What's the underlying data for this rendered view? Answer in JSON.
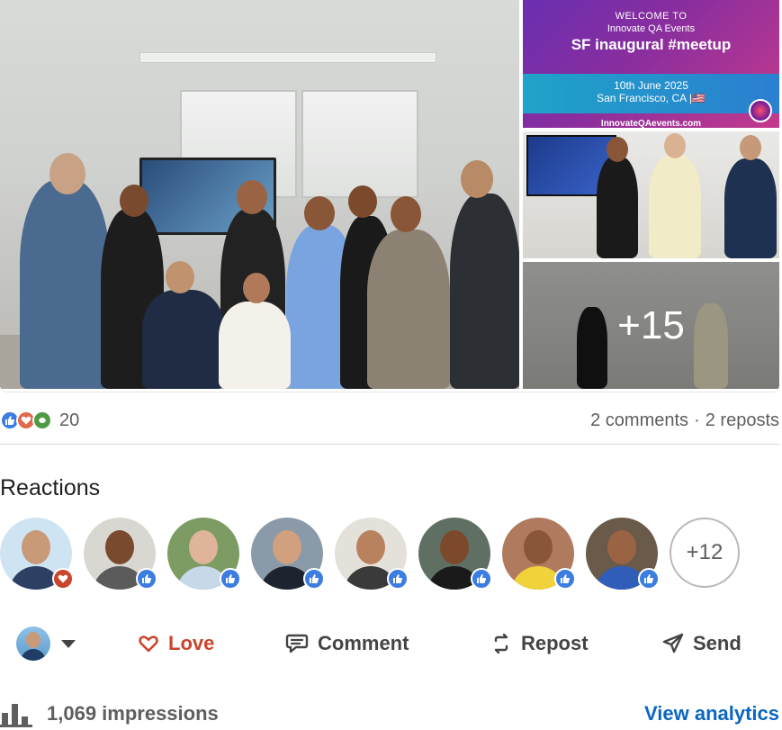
{
  "gallery": {
    "banner": {
      "line1": "WELCOME TO",
      "line2": "Innovate QA Events",
      "title": "SF inaugural #meetup",
      "date": "10th June 2025",
      "city": "San Francisco, CA |🇺🇸",
      "url": "InnovateQAevents.com"
    },
    "more_count": "+15"
  },
  "counts": {
    "reaction_icons": [
      "like-icon",
      "love-icon",
      "support-icon"
    ],
    "total": "20",
    "comments": "2 comments",
    "separator": "·",
    "reposts": "2 reposts"
  },
  "reactions": {
    "heading": "Reactions",
    "people": [
      {
        "badge": "love",
        "bg": "#cfe4f2",
        "skin": "#c99a78",
        "shirt": "#2d3f63"
      },
      {
        "badge": "like",
        "bg": "#d9d7d2",
        "skin": "#7a4a2e",
        "shirt": "#5b5b5b"
      },
      {
        "badge": "like",
        "bg": "#7c9c63",
        "skin": "#e0b49a",
        "shirt": "#c7d8e8"
      },
      {
        "badge": "like",
        "bg": "#8a9aa8",
        "skin": "#d1a07e",
        "shirt": "#1e2330"
      },
      {
        "badge": "like",
        "bg": "#e4e0da",
        "skin": "#b8825e",
        "shirt": "#3a3a3a"
      },
      {
        "badge": "like",
        "bg": "#5f6f63",
        "skin": "#7b4a2c",
        "shirt": "#1a1a1a"
      },
      {
        "badge": "like",
        "bg": "#b07a5e",
        "skin": "#8a5638",
        "shirt": "#f0d23a"
      },
      {
        "badge": "like",
        "bg": "#6a5a4a",
        "skin": "#9a6444",
        "shirt": "#2f5db8"
      }
    ],
    "more": "+12"
  },
  "actions": {
    "love": "Love",
    "comment": "Comment",
    "repost": "Repost",
    "send": "Send"
  },
  "footer": {
    "impressions": "1,069 impressions",
    "analytics": "View analytics"
  },
  "colors": {
    "love": "#c9452c",
    "link": "#0a66c2",
    "like": "#3b7de0",
    "support": "#4f9a45"
  }
}
